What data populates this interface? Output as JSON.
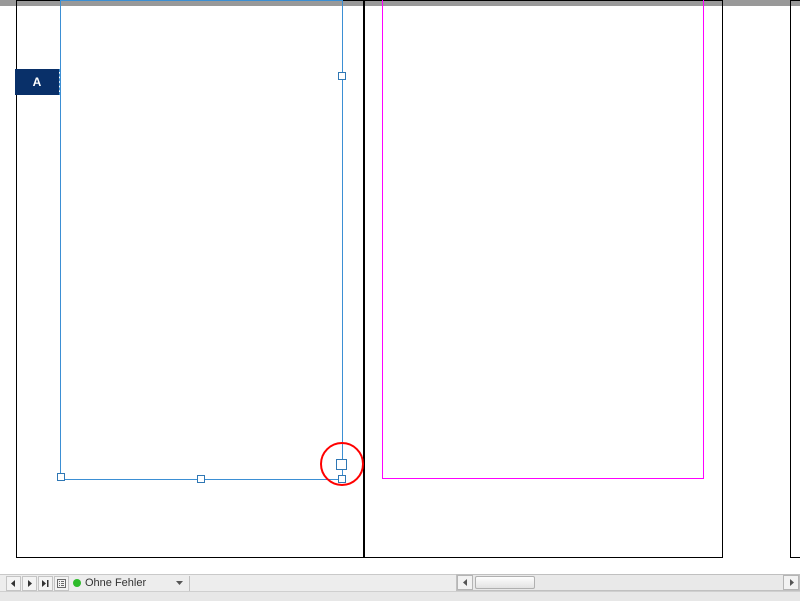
{
  "master_badge": {
    "label": "A"
  },
  "statusbar": {
    "preflight_text": "Ohne Fehler"
  },
  "nav_icons": {
    "prev": "prev-arrow",
    "next": "next-arrow",
    "last": "last-arrow",
    "open": "open-icon"
  }
}
